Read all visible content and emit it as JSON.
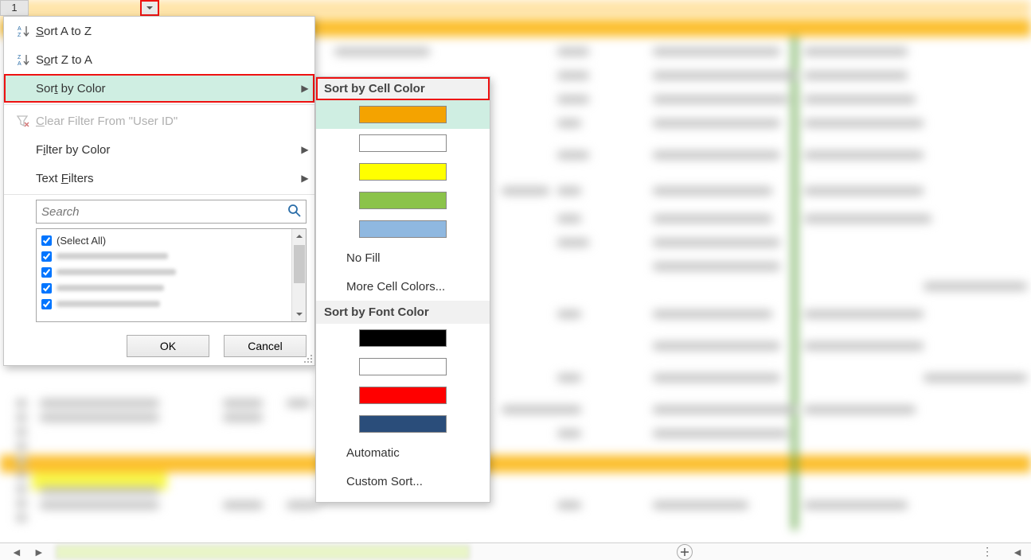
{
  "rownum": "1",
  "filterMenu": {
    "sortAZ": "Sort A to Z",
    "sortZA": "Sort Z to A",
    "sortByColor": "Sort by Color",
    "clearFilter": "Clear Filter From \"User ID\"",
    "filterByColor": "Filter by Color",
    "textFilters": "Text Filters",
    "searchPlaceholder": "Search",
    "selectAll": "(Select All)",
    "ok": "OK",
    "cancel": "Cancel"
  },
  "submenu": {
    "cellColorTitle": "Sort by Cell Color",
    "noFill": "No Fill",
    "moreCellColors": "More Cell Colors...",
    "fontColorTitle": "Sort by Font Color",
    "automatic": "Automatic",
    "customSort": "Custom Sort...",
    "cellColors": [
      "#f4a300",
      "#ffffff",
      "#ffff00",
      "#8bc34a",
      "#8fb8e0"
    ],
    "fontColors": [
      "#000000",
      "#ffffff",
      "#ff0000",
      "#2a4d7a"
    ]
  }
}
